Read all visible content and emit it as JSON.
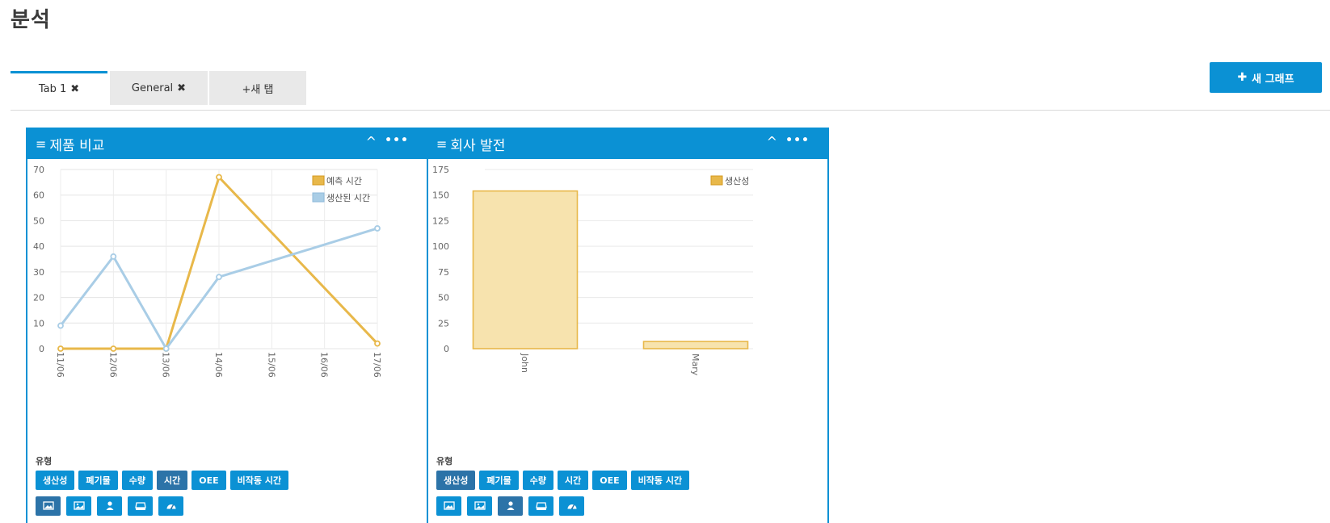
{
  "page": {
    "title": "분석"
  },
  "tabs": [
    {
      "label": "Tab 1",
      "close": "✖",
      "active": true
    },
    {
      "label": "General",
      "close": "✖",
      "active": false
    },
    {
      "label": "+새 탭",
      "close": "",
      "active": false
    }
  ],
  "new_graph_button": {
    "icon": "✚",
    "label": "새 그래프"
  },
  "type_label": "유형",
  "type_buttons": [
    "생산성",
    "폐기물",
    "수량",
    "시간",
    "OEE",
    "비작동 시간"
  ],
  "icon_buttons": [
    "image-icon",
    "picture-icon",
    "user-icon",
    "machine-icon",
    "gauge-icon"
  ],
  "panels": [
    {
      "title": "제품 비교",
      "menu_icon": "≡",
      "collapse_icon": "^",
      "more_icon": "•••",
      "selected_type": "시간",
      "selected_icon": "image-icon"
    },
    {
      "title": "회사 발전",
      "menu_icon": "≡",
      "collapse_icon": "^",
      "more_icon": "•••",
      "selected_type": "생산성",
      "selected_icon": "user-icon"
    }
  ],
  "colors": {
    "accent": "#0b91d4",
    "selected": "#2c73a8",
    "series_gold": "#e8b84a",
    "series_blue": "#a9cde6"
  },
  "chart_data": [
    {
      "type": "line",
      "x": [
        "11/06",
        "12/06",
        "13/06",
        "14/06",
        "15/06",
        "16/06",
        "17/06"
      ],
      "yticks": [
        0,
        10,
        20,
        30,
        40,
        50,
        60,
        70
      ],
      "ylim": [
        0,
        70
      ],
      "series": [
        {
          "name": "예측 시간",
          "values": [
            0,
            0,
            0,
            67,
            null,
            null,
            2
          ],
          "color": "#e8b84a"
        },
        {
          "name": "생산된 시간",
          "values": [
            9,
            36,
            0,
            28,
            null,
            null,
            47
          ],
          "color": "#a9cde6"
        }
      ],
      "legend": "top-right",
      "grid": true
    },
    {
      "type": "bar",
      "categories": [
        "John",
        "Mary"
      ],
      "yticks": [
        0,
        25,
        50,
        75,
        100,
        125,
        150,
        175
      ],
      "ylim": [
        0,
        175
      ],
      "series": [
        {
          "name": "생산성",
          "values": [
            154,
            7
          ],
          "color": "#e8b84a"
        }
      ],
      "legend": "top-right",
      "grid": true
    }
  ]
}
